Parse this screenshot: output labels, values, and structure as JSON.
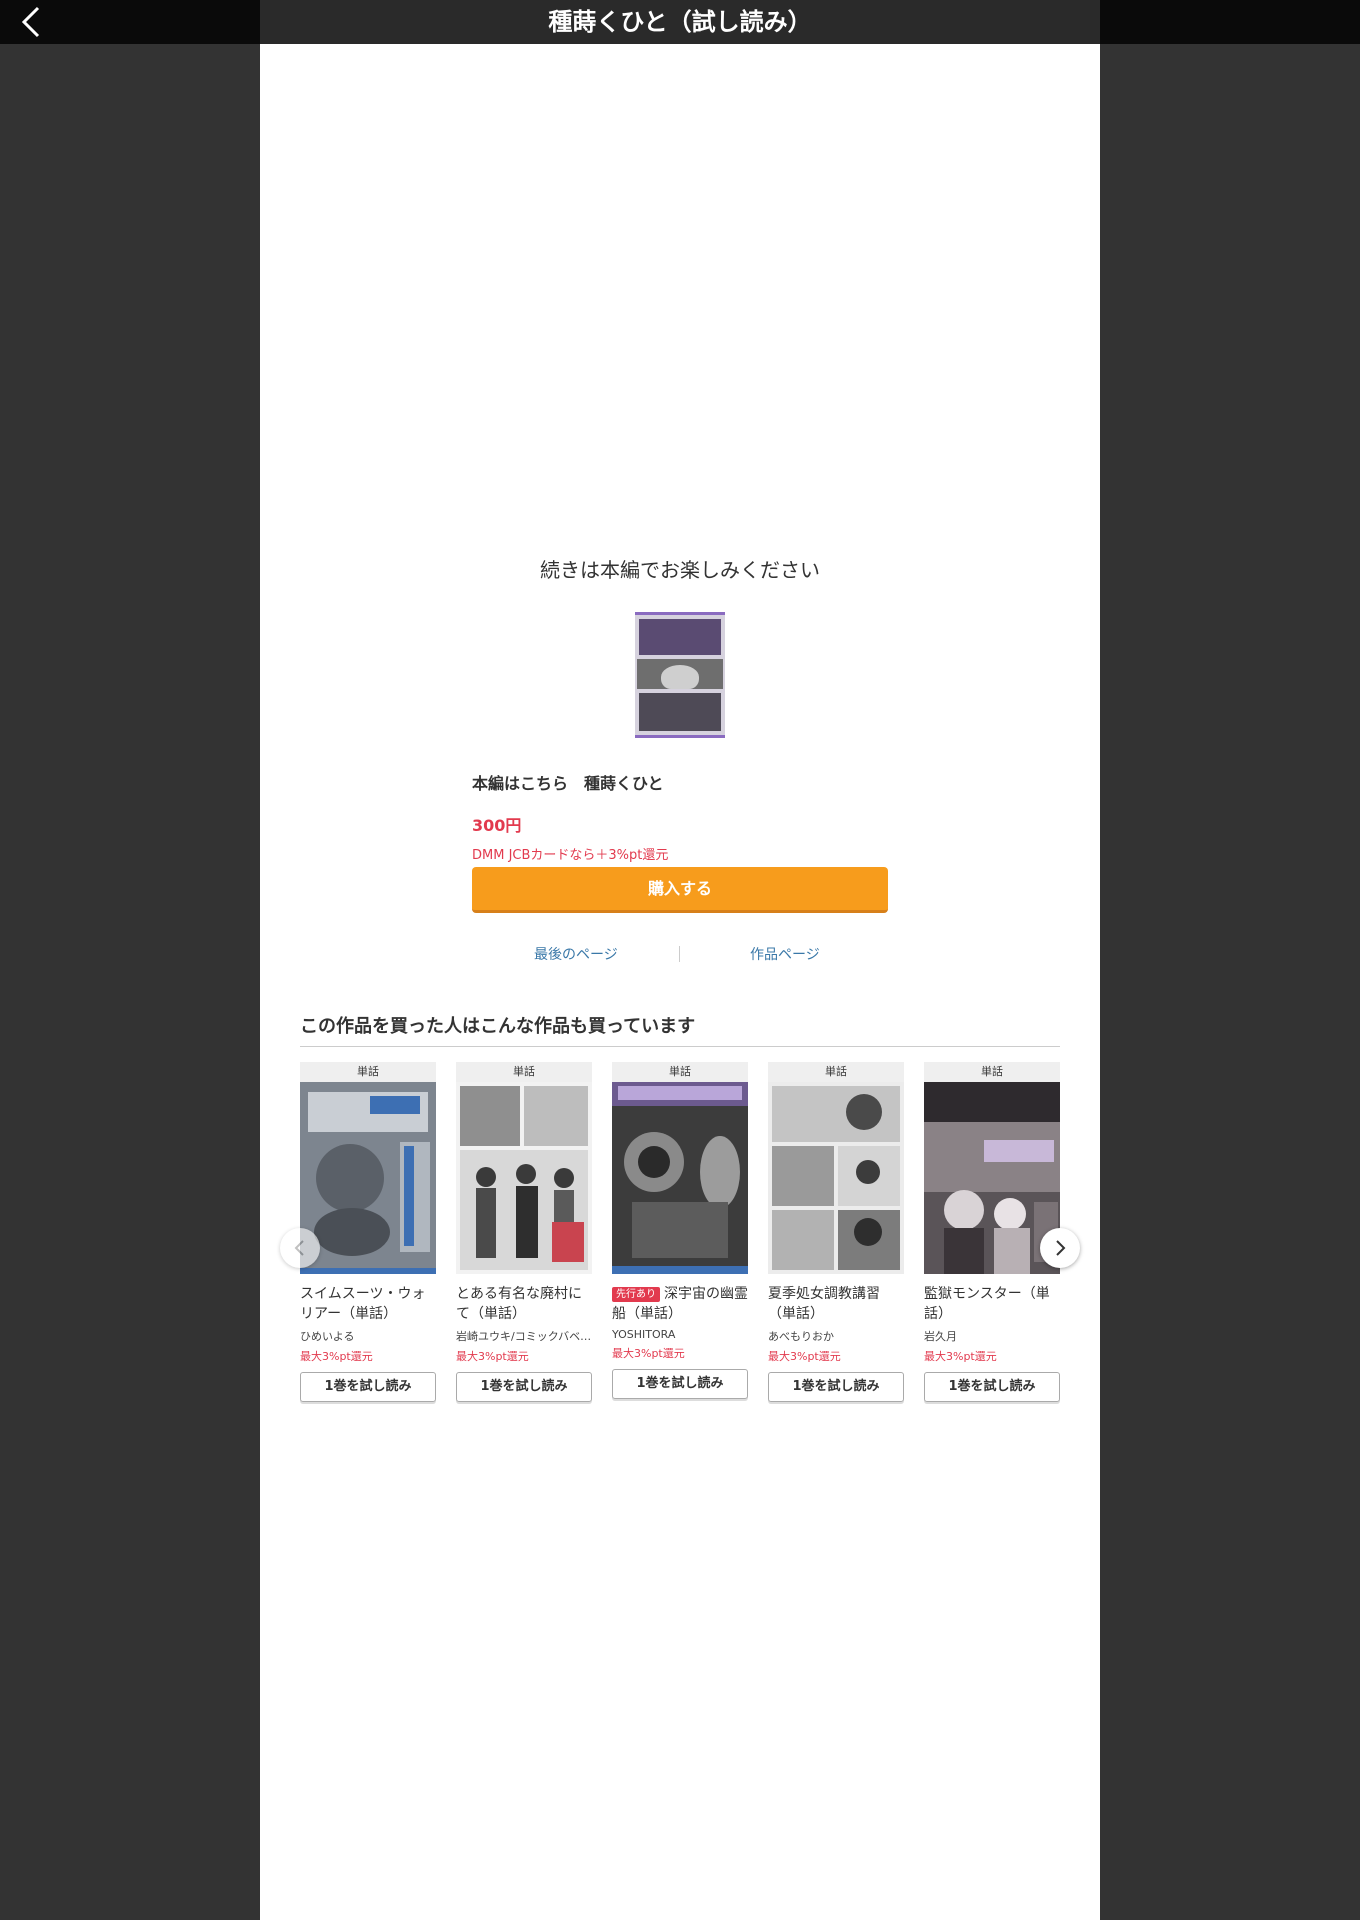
{
  "header": {
    "title": "種蒔くひと（試し読み）"
  },
  "main": {
    "continue_text": "続きは本編でお楽しみください",
    "main_title": "本編はこちら　種蒔くひと",
    "price": "300円",
    "points": "DMM JCBカードなら＋3%pt還元",
    "buy_label": "購入する",
    "last_page_label": "最後のページ",
    "work_page_label": "作品ページ"
  },
  "recommend": {
    "title": "この作品を買った人はこんな作品も買っています",
    "items": [
      {
        "tag": "単話",
        "badge": "",
        "name": "スイムスーツ・ウォリアー（単話）",
        "author": "ひめいよる",
        "points": "最大3%pt還元",
        "trial": "1巻を試し読み"
      },
      {
        "tag": "単話",
        "badge": "",
        "name": "とある有名な廃村にて（単話）",
        "author": "岩崎ユウキ/コミックバベ…",
        "points": "最大3%pt還元",
        "trial": "1巻を試し読み"
      },
      {
        "tag": "単話",
        "badge": "先行あり",
        "name": "深宇宙の幽霊船（単話）",
        "author": "YOSHITORA",
        "points": "最大3%pt還元",
        "trial": "1巻を試し読み"
      },
      {
        "tag": "単話",
        "badge": "",
        "name": "夏季処女調教講習（単話）",
        "author": "あべもりおか",
        "points": "最大3%pt還元",
        "trial": "1巻を試し読み"
      },
      {
        "tag": "単話",
        "badge": "",
        "name": "監獄モンスター（単話）",
        "author": "岩久月",
        "points": "最大3%pt還元",
        "trial": "1巻を試し読み"
      }
    ]
  },
  "colors": {
    "accent_orange": "#f79c1c",
    "price_red": "#e23a4e",
    "link_blue": "#3a78a8"
  },
  "icons": {
    "back": "chevron-left-icon",
    "prev": "chevron-left-icon",
    "next": "chevron-right-icon"
  }
}
